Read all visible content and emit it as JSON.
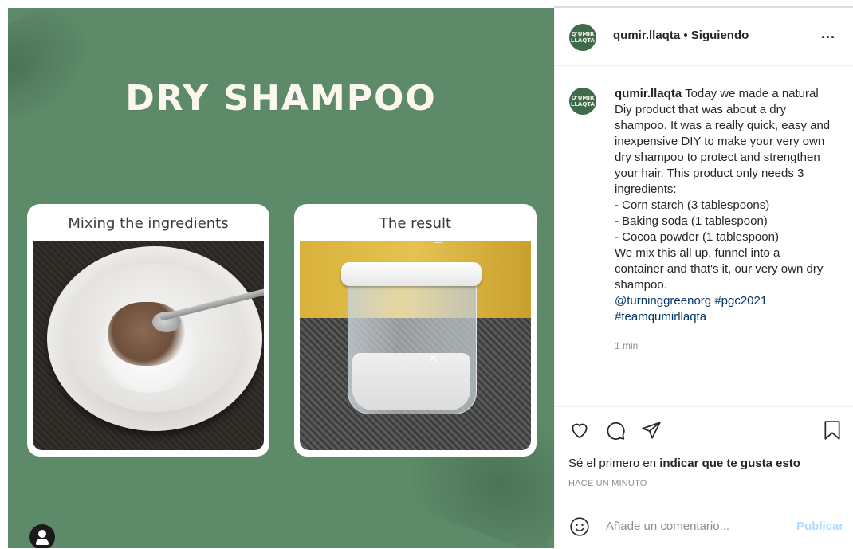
{
  "media": {
    "title": "DRY SHAMPOO",
    "card1_caption": "Mixing the ingredients",
    "card2_caption": "The result"
  },
  "header": {
    "username": "qumir.llaqta",
    "separator": "•",
    "follow_state": "Siguiendo",
    "more": "..."
  },
  "avatar": {
    "line1": "Q'UMIR",
    "line2": "LLAQTA"
  },
  "caption": {
    "username": "qumir.llaqta",
    "lines": [
      "Today we made a natural",
      "Diy product that was about a dry",
      "shampoo. It was a really quick, easy and",
      "inexpensive DIY to make your very own",
      "dry shampoo to protect and strengthen",
      "your hair. This product only needs 3",
      "ingredients:",
      "- Corn starch (3 tablespoons)",
      "- Baking soda (1 tablespoon)",
      "- Cocoa powder (1 tablespoon)",
      "We mix this all up, funnel into a",
      "container and that's it, our very own dry",
      "shampoo."
    ],
    "mention": "@turninggreenorg",
    "hashtag1": "#pgc2021",
    "hashtag2": "#teamqumirllaqta",
    "time": "1 min"
  },
  "likes": {
    "prefix": "Sé el primero en ",
    "action": "indicar que te gusta esto"
  },
  "posted": "HACE UN MINUTO",
  "composer": {
    "placeholder": "Añade un comentario...",
    "publish": "Publicar"
  },
  "icons": {
    "like": "heart-icon",
    "comment": "comment-icon",
    "share": "share-icon",
    "save": "bookmark-icon",
    "emoji": "emoji-icon",
    "user_tag": "user-icon"
  },
  "colors": {
    "media_bg": "#5d8a69",
    "link": "#00376b",
    "publish_disabled": "#b3dbff"
  }
}
